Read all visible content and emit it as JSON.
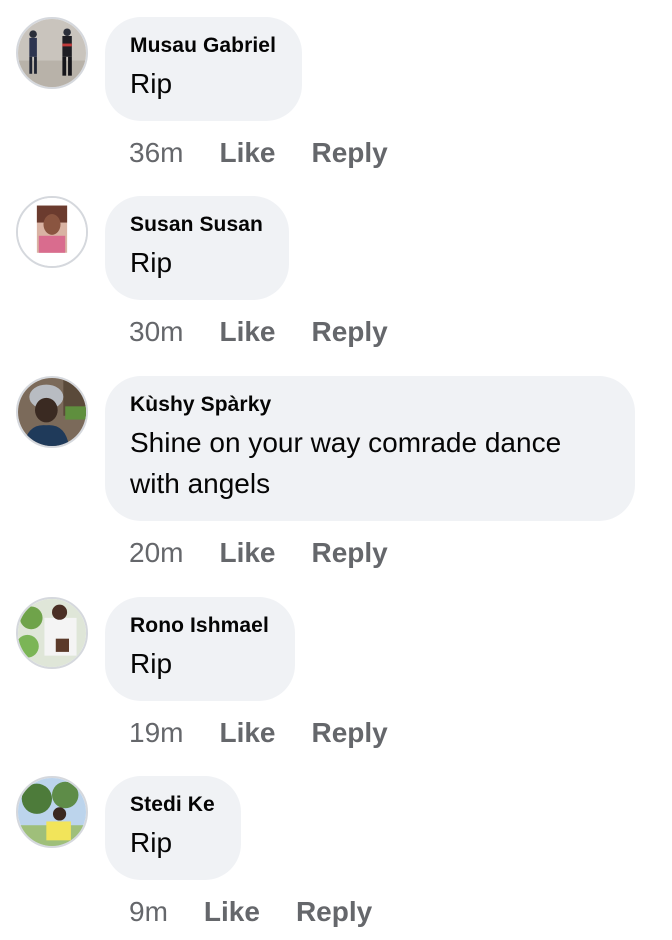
{
  "comments": [
    {
      "author": "Musau Gabriel",
      "text": "Rip",
      "time": "36m",
      "like": "Like",
      "reply": "Reply",
      "avatar": "avatar-two-people-walking"
    },
    {
      "author": "Susan Susan",
      "text": "Rip",
      "time": "30m",
      "like": "Like",
      "reply": "Reply",
      "avatar": "avatar-woman-portrait"
    },
    {
      "author": "Kùshy Spàrky",
      "text": "Shine on your way comrade dance with angels",
      "time": "20m",
      "like": "Like",
      "reply": "Reply",
      "avatar": "avatar-person-in-beanie"
    },
    {
      "author": "Rono Ishmael",
      "text": "Rip",
      "time": "19m",
      "like": "Like",
      "reply": "Reply",
      "avatar": "avatar-man-outdoors"
    },
    {
      "author": "Stedi Ke",
      "text": "Rip",
      "time": "9m",
      "like": "Like",
      "reply": "Reply",
      "avatar": "avatar-person-under-tree"
    }
  ],
  "colors": {
    "bubble_bg": "#f0f2f5",
    "text": "#050505",
    "meta": "#65676b",
    "avatar_border": "#d5d8dd"
  }
}
